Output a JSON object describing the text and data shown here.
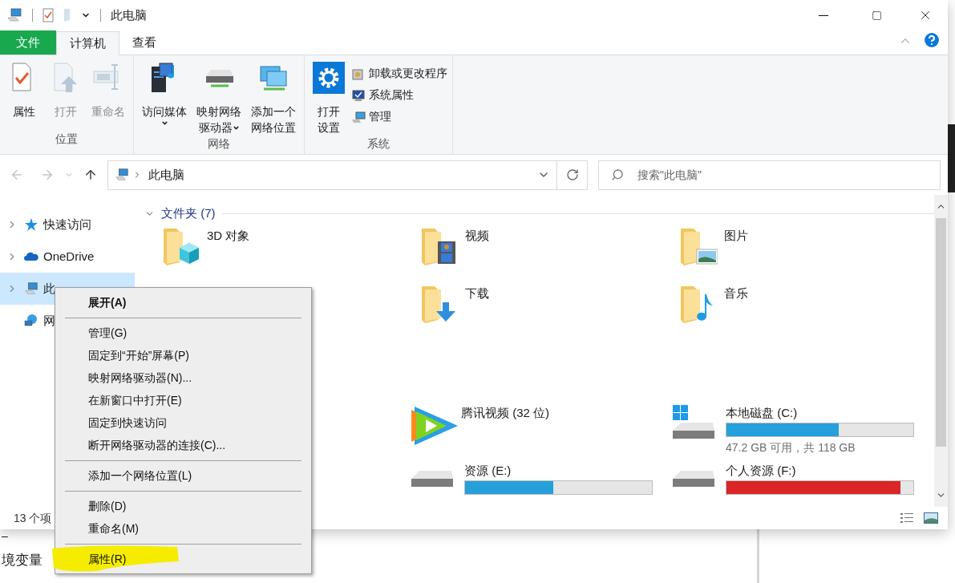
{
  "window": {
    "title": "此电脑"
  },
  "ribbon": {
    "tabs": [
      {
        "label": "文件",
        "kind": "file",
        "selected": false
      },
      {
        "label": "计算机",
        "kind": "tab",
        "selected": true
      },
      {
        "label": "查看",
        "kind": "tab",
        "selected": false
      }
    ],
    "groups": [
      {
        "label": "位置",
        "items": [
          {
            "kind": "large",
            "lines": [
              "属性"
            ],
            "disabled": false,
            "dropdown": false
          },
          {
            "kind": "large",
            "lines": [
              "打开"
            ],
            "disabled": true,
            "dropdown": false
          },
          {
            "kind": "large",
            "lines": [
              "重命名"
            ],
            "disabled": true,
            "dropdown": false
          }
        ]
      },
      {
        "label": "网络",
        "items": [
          {
            "kind": "large",
            "lines": [
              "访问媒体"
            ],
            "disabled": false,
            "dropdown": true
          },
          {
            "kind": "large",
            "lines": [
              "映射网络",
              "驱动器"
            ],
            "disabled": false,
            "dropdown": true
          },
          {
            "kind": "large",
            "lines": [
              "添加一个",
              "网络位置"
            ],
            "disabled": false,
            "dropdown": false
          }
        ]
      },
      {
        "label": "系统",
        "items": [
          {
            "kind": "large",
            "lines": [
              "打开",
              "设置"
            ],
            "disabled": false,
            "dropdown": false
          },
          {
            "kind": "small",
            "lines": [
              "卸载或更改程序"
            ],
            "disabled": false
          },
          {
            "kind": "small",
            "lines": [
              "系统属性"
            ],
            "disabled": false
          },
          {
            "kind": "small",
            "lines": [
              "管理"
            ],
            "disabled": false
          }
        ]
      }
    ]
  },
  "address": {
    "path": "此电脑",
    "search_placeholder": "搜索\"此电脑\""
  },
  "nav_pane": [
    {
      "label": "快速访问",
      "expandable": true,
      "selected": false
    },
    {
      "label": "OneDrive",
      "expandable": true,
      "selected": false
    },
    {
      "label": "此",
      "expandable": true,
      "selected": true
    },
    {
      "label": "网",
      "expandable": false,
      "selected": false
    }
  ],
  "folders": {
    "heading": "文件夹 (7)",
    "expanded": true,
    "items": [
      {
        "name": "3D 对象"
      },
      {
        "name": "视频"
      },
      {
        "name": "图片"
      },
      {
        "name": "下载"
      },
      {
        "name": "音乐"
      }
    ]
  },
  "drives": [
    {
      "kind": "app",
      "name": "腾讯视频 (32 位)"
    },
    {
      "kind": "disk",
      "name": "本地磁盘 (C:)",
      "system": true,
      "level": 0.6,
      "color": "#26a0da",
      "free": "47.2 GB 可用，共 118 GB"
    },
    {
      "kind": "disk",
      "name": "资源 (E:)",
      "system": false,
      "level": 0.47,
      "color": "#26a0da"
    },
    {
      "kind": "disk",
      "name": "个人资源 (F:)",
      "system": false,
      "level": 0.93,
      "color": "#da2626"
    }
  ],
  "status_bar": {
    "count": "13 个项"
  },
  "context_menu": {
    "items": [
      {
        "kind": "item",
        "label": "展开(A)",
        "bold": true
      },
      {
        "kind": "separator"
      },
      {
        "kind": "item",
        "label": "管理(G)",
        "bold": false
      },
      {
        "kind": "item",
        "label": "固定到“开始”屏幕(P)",
        "bold": false
      },
      {
        "kind": "item",
        "label": "映射网络驱动器(N)...",
        "bold": false
      },
      {
        "kind": "item",
        "label": "在新窗口中打开(E)",
        "bold": false
      },
      {
        "kind": "item",
        "label": "固定到快速访问",
        "bold": false
      },
      {
        "kind": "item",
        "label": "断开网络驱动器的连接(C)...",
        "bold": false
      },
      {
        "kind": "separator"
      },
      {
        "kind": "item",
        "label": "添加一个网络位置(L)",
        "bold": false
      },
      {
        "kind": "separator"
      },
      {
        "kind": "item",
        "label": "删除(D)",
        "bold": false
      },
      {
        "kind": "item",
        "label": "重命名(M)",
        "bold": false
      },
      {
        "kind": "separator"
      },
      {
        "kind": "item",
        "label": "属性(R)",
        "bold": false
      }
    ]
  },
  "background_document": {
    "lines": [
      "–",
      "境变量"
    ]
  }
}
